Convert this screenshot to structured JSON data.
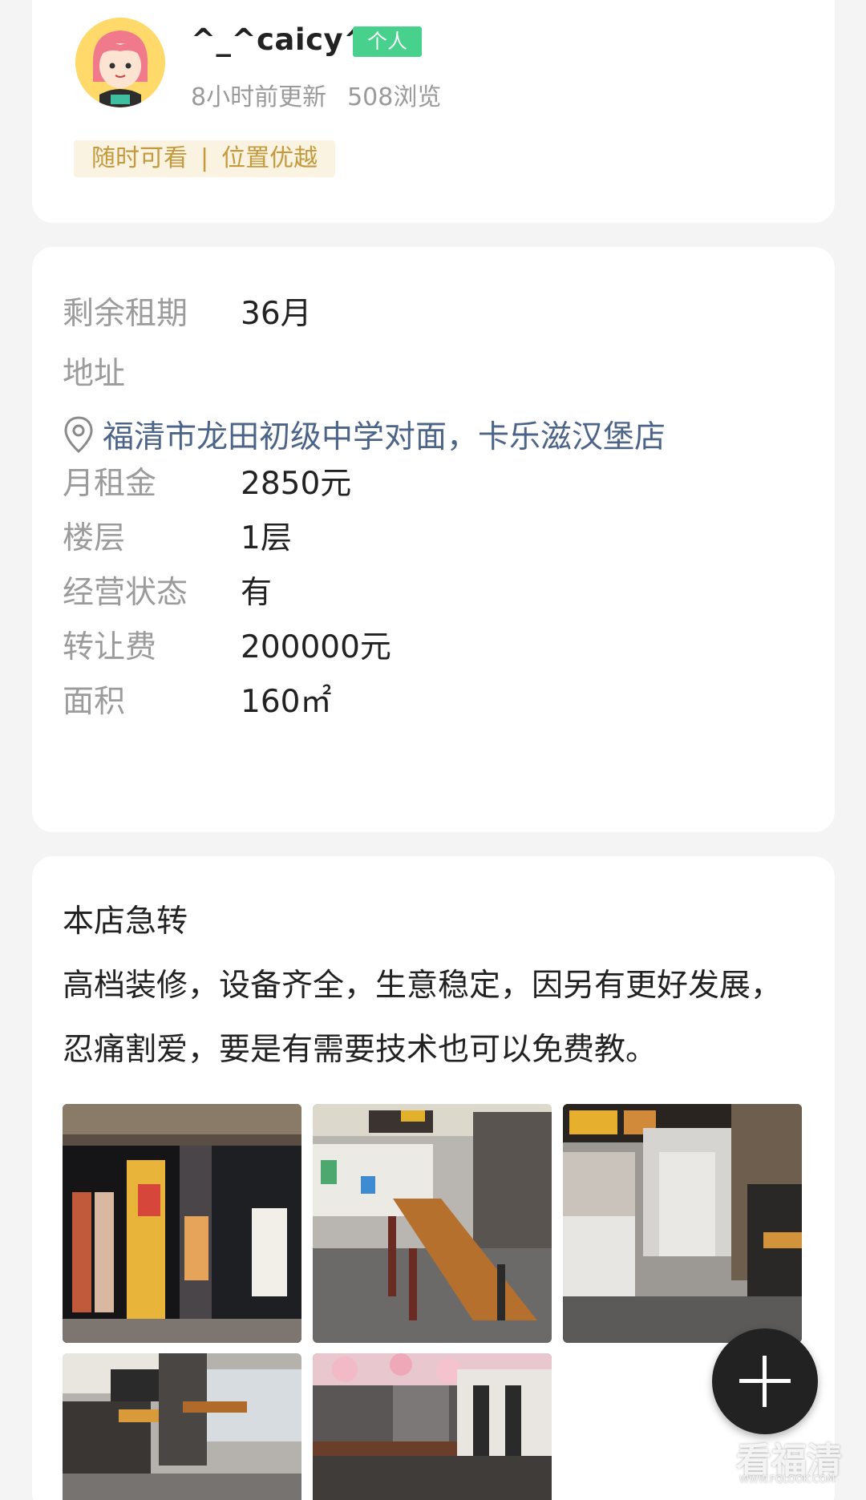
{
  "user": {
    "name": "^_^caicy^_",
    "tag": "个人",
    "updated": "8小时前更新",
    "views": "508浏览"
  },
  "features": {
    "first": "随时可看",
    "separator": "|",
    "second": "位置优越"
  },
  "details": {
    "lease_label": "剩余租期",
    "lease_value": "36月",
    "address_label": "地址",
    "address": "福清市龙田初级中学对面，卡乐滋汉堡店",
    "rent_label": "月租金",
    "rent_value": "2850元",
    "floor_label": "楼层",
    "floor_value": "1层",
    "status_label": "经营状态",
    "status_value": "有",
    "fee_label": "转让费",
    "fee_value": "200000元",
    "area_label": "面积",
    "area_value": "160㎡"
  },
  "description": {
    "title": "本店急转",
    "body": "高档装修，设备齐全，生意稳定，因另有更好发展，忍痛割爱，要是有需要技术也可以免费教。"
  },
  "watermark": {
    "main": "看福清",
    "sub": "WWW.FQLOOK.COM"
  },
  "colors": {
    "accent_green": "#47d18c",
    "address_blue": "#4d6489",
    "feature_gold": "#c49a3c"
  }
}
